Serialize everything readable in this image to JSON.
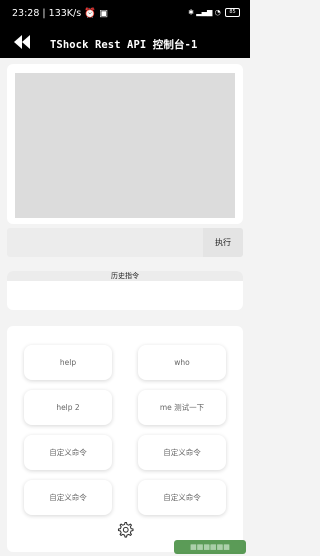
{
  "status": {
    "time": "23:28",
    "speed": "133K/s",
    "battery": "85"
  },
  "appbar": {
    "title": "TShock Rest API 控制台-1"
  },
  "command": {
    "placeholder": "",
    "exec_label": "执行"
  },
  "history": {
    "title": "历史指令"
  },
  "quick_buttons": [
    "help",
    "who",
    "help 2",
    "me 测试一下",
    "自定义命令",
    "自定义命令",
    "自定义命令",
    "自定义命令"
  ],
  "icons": {
    "back": "double-arrow-left-icon",
    "settings": "gear-icon"
  },
  "colors": {
    "bar": "#000000",
    "output_bg": "#dcdcdc",
    "page_bg": "#f3f3f3"
  }
}
